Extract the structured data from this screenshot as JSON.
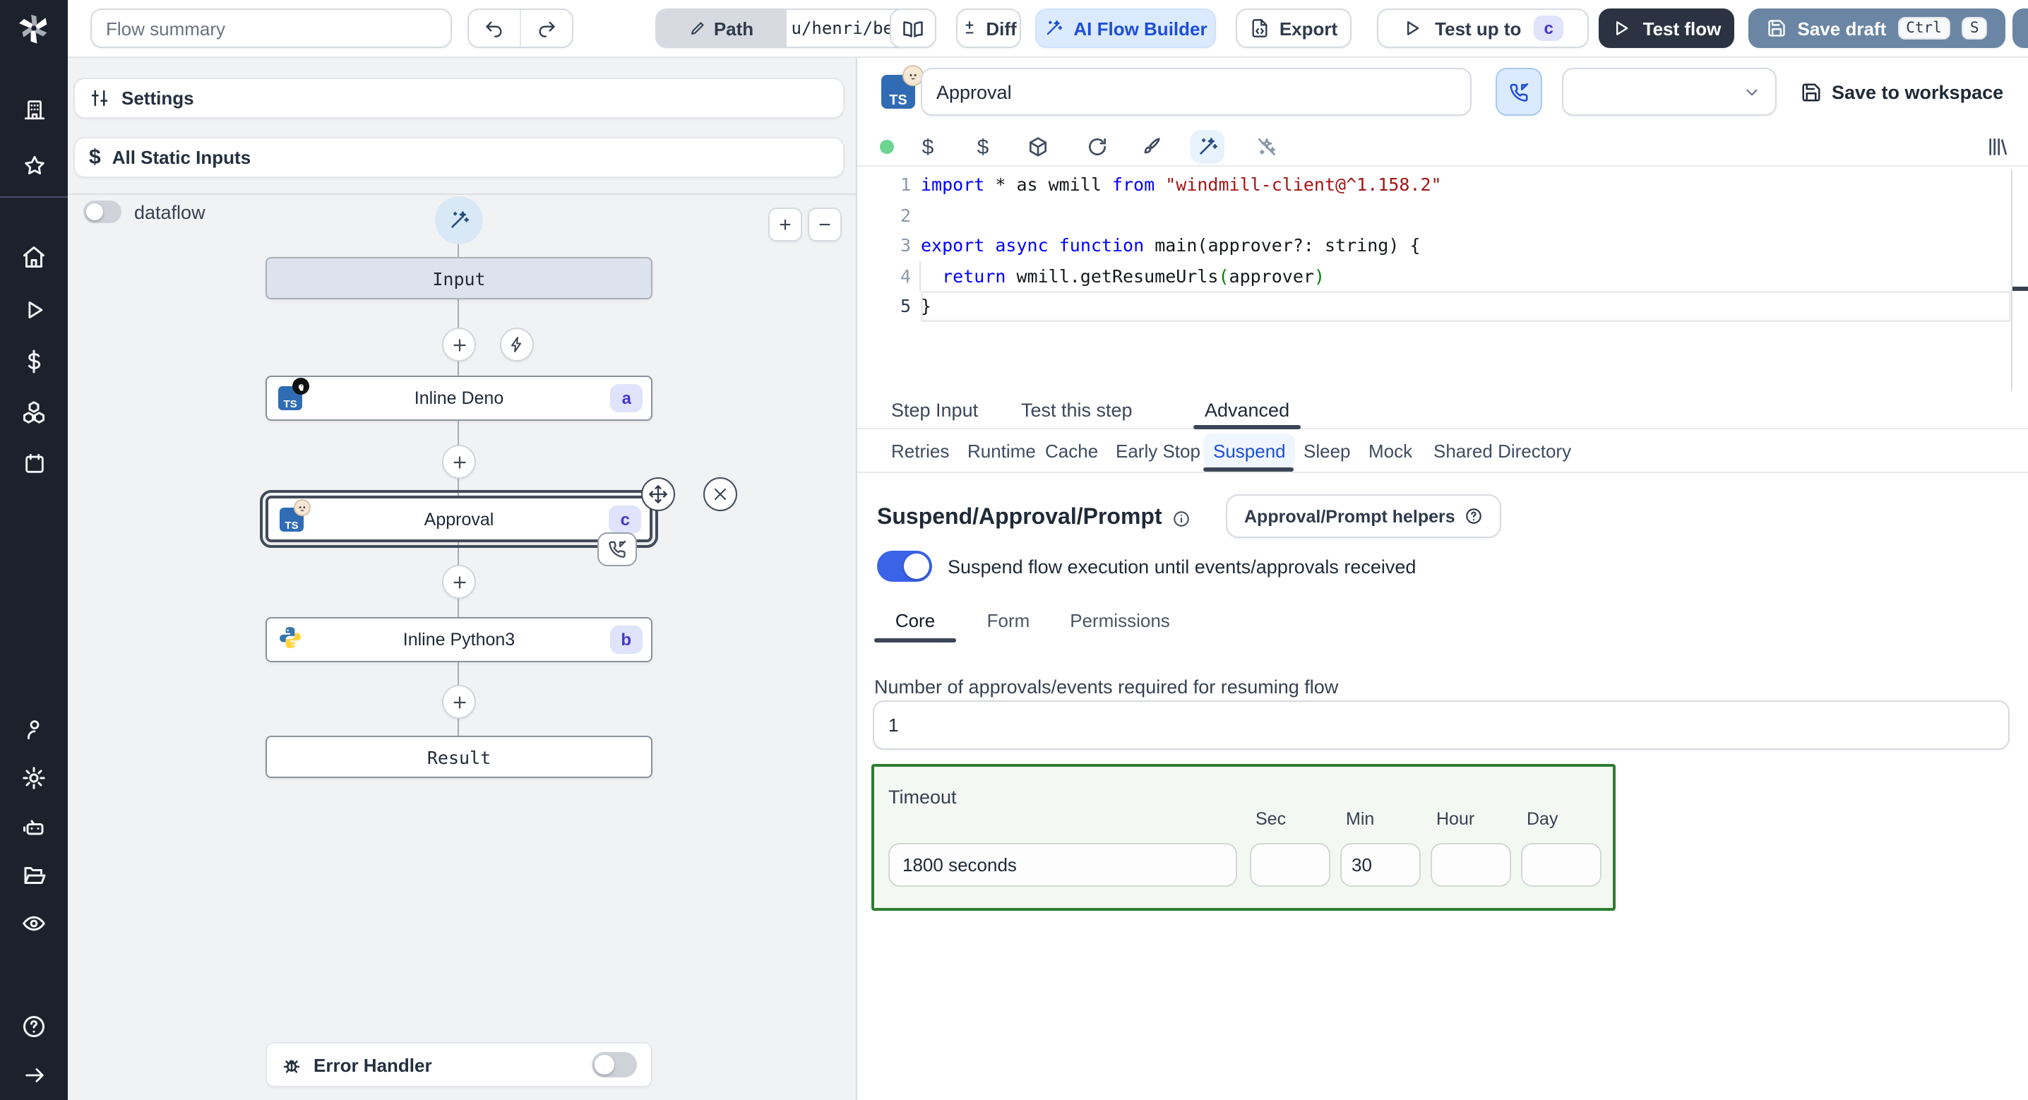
{
  "topbar": {
    "flow_summary_placeholder": "Flow summary",
    "path_label": "Path",
    "path_value": "u/henri/bes",
    "diff_label": "Diff",
    "ai_flow_builder_label": "AI Flow Builder",
    "export_label": "Export",
    "test_up_to_label": "Test up to",
    "test_up_to_badge": "c",
    "test_flow_label": "Test flow",
    "save_draft_label": "Save draft",
    "shortcut_ctrl": "Ctrl",
    "shortcut_s": "S"
  },
  "left_panel": {
    "settings_label": "Settings",
    "all_static_inputs_label": "All Static Inputs",
    "dataflow_label": "dataflow",
    "zoom_in_label": "+",
    "zoom_out_label": "−",
    "graph": {
      "input_label": "Input",
      "steps": [
        {
          "name": "Inline Deno",
          "badge": "a"
        },
        {
          "name": "Approval",
          "badge": "c"
        },
        {
          "name": "Inline Python3",
          "badge": "b"
        }
      ],
      "result_label": "Result"
    },
    "error_handler_label": "Error Handler"
  },
  "editor": {
    "step_name_value": "Approval",
    "save_to_workspace_label": "Save to workspace",
    "code": {
      "line_numbers": [
        "1",
        "2",
        "3",
        "4",
        "5"
      ],
      "lines": [
        [
          [
            "kw",
            "import"
          ],
          [
            "pl",
            " * as wmill "
          ],
          [
            "kw",
            "from"
          ],
          [
            "pl",
            " "
          ],
          [
            "str",
            "\"windmill-client@^1.158.2\""
          ]
        ],
        [
          [
            "pl",
            ""
          ]
        ],
        [
          [
            "kw",
            "export"
          ],
          [
            "pl",
            " "
          ],
          [
            "kw",
            "async"
          ],
          [
            "pl",
            " "
          ],
          [
            "kw",
            "function"
          ],
          [
            "pl",
            " main(approver?: string) {"
          ]
        ],
        [
          [
            "pl",
            "  "
          ],
          [
            "kw",
            "return"
          ],
          [
            "pl",
            " wmill.getResumeUrls"
          ],
          [
            "grn",
            "("
          ],
          [
            "pl",
            "approver"
          ],
          [
            "grn",
            ")"
          ]
        ],
        [
          [
            "pl",
            "}"
          ]
        ]
      ]
    },
    "tabs": [
      {
        "label": "Step Input"
      },
      {
        "label": "Test this step"
      },
      {
        "label": "Advanced"
      }
    ],
    "advanced_tabs": [
      {
        "label": "Retries"
      },
      {
        "label": "Runtime"
      },
      {
        "label": "Cache"
      },
      {
        "label": "Early Stop"
      },
      {
        "label": "Suspend"
      },
      {
        "label": "Sleep"
      },
      {
        "label": "Mock"
      },
      {
        "label": "Shared Directory"
      }
    ],
    "suspend": {
      "heading": "Suspend/Approval/Prompt",
      "helpers_button_label": "Approval/Prompt helpers",
      "toggle_label": "Suspend flow execution until events/approvals received",
      "tabs": [
        {
          "label": "Core"
        },
        {
          "label": "Form"
        },
        {
          "label": "Permissions"
        }
      ],
      "approvals_label": "Number of approvals/events required for resuming flow",
      "approvals_value": "1",
      "timeout": {
        "label": "Timeout",
        "total_value": "1800 seconds",
        "units": [
          {
            "label": "Sec",
            "value": ""
          },
          {
            "label": "Min",
            "value": "30"
          },
          {
            "label": "Hour",
            "value": ""
          },
          {
            "label": "Day",
            "value": ""
          }
        ]
      }
    }
  },
  "colors": {
    "accent_blue": "#1d4ed8",
    "toggle_on": "#3b63e8",
    "timeout_border": "#2e7d32",
    "badge_bg": "#dfe3fb",
    "badge_text": "#4338ca",
    "keyword": "#0000ff",
    "string": "#a31515"
  }
}
